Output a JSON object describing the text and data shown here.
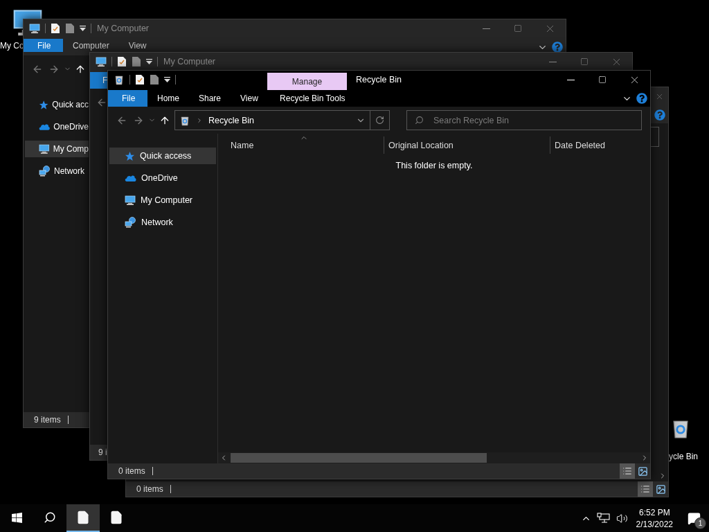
{
  "desktop_icons": [
    {
      "kind": "computer",
      "label": "My Co"
    },
    {
      "kind": "recycle",
      "label": "ycle Bin"
    }
  ],
  "back_window": {
    "kind": "computer",
    "title": "My Computer",
    "ribbon_tabs": [
      {
        "kind": "file",
        "label": "File"
      },
      {
        "kind": "tab",
        "label": "Computer"
      },
      {
        "kind": "tab",
        "label": "View"
      }
    ],
    "nav_items": [
      {
        "kind": "star",
        "label": "Quick acc",
        "selected": false
      },
      {
        "kind": "cloud",
        "label": "OneDrive",
        "selected": false
      },
      {
        "kind": "computer",
        "label": "My Comp",
        "selected": true
      },
      {
        "kind": "network",
        "label": "Network",
        "selected": false
      }
    ],
    "status": "9 items"
  },
  "middle_window": {
    "kind": "computer",
    "title": "My Computer",
    "ribbon_tabs": [
      {
        "kind": "file",
        "label": "F"
      }
    ],
    "status": "9 i"
  },
  "rear_recycle_window": {
    "status": "0 items",
    "views": [
      {
        "selected": true
      },
      {
        "selected": false
      }
    ]
  },
  "front_window": {
    "kind": "recycle",
    "title": "Recycle Bin",
    "context_group": "Manage",
    "ribbon_tabs": [
      {
        "kind": "file",
        "label": "File"
      },
      {
        "kind": "tab",
        "label": "Home"
      },
      {
        "kind": "tab",
        "label": "Share"
      },
      {
        "kind": "tab",
        "label": "View"
      },
      {
        "kind": "context",
        "label": "Recycle Bin Tools"
      }
    ],
    "address": "Recycle Bin",
    "search": {
      "placeholder": "Search Recycle Bin"
    },
    "nav_items": [
      {
        "kind": "star",
        "label": "Quick access",
        "selected": true
      },
      {
        "kind": "cloud",
        "label": "OneDrive",
        "selected": false
      },
      {
        "kind": "computer",
        "label": "My Computer",
        "selected": false
      },
      {
        "kind": "network",
        "label": "Network",
        "selected": false
      }
    ],
    "columns": [
      "Name",
      "Original Location",
      "Date Deleted"
    ],
    "empty_message": "This folder is empty.",
    "status": "0 items",
    "views": [
      {
        "selected": true
      },
      {
        "selected": false
      }
    ]
  },
  "taskbar": {
    "apps": [
      {
        "selected": true
      },
      {
        "selected": false
      }
    ],
    "clock": {
      "time": "6:52 PM",
      "date": "2/13/2022"
    },
    "notifications": "1"
  }
}
